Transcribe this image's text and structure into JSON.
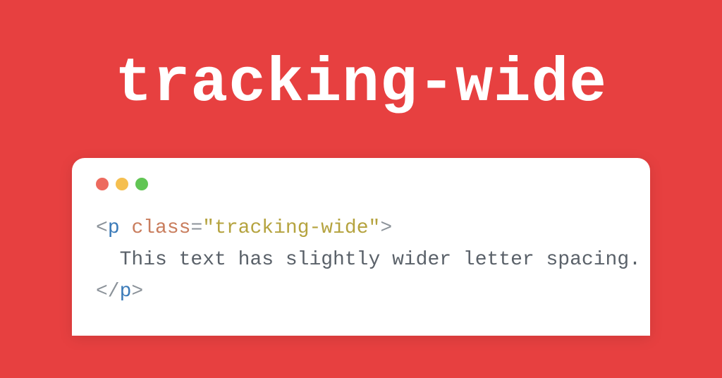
{
  "title": "tracking-wide",
  "code": {
    "tag_name": "p",
    "attr_name": "class",
    "attr_value": "\"tracking-wide\"",
    "text_content": "This text has slightly wider letter spacing.",
    "open_bracket": "<",
    "close_bracket": ">",
    "close_open_bracket": "</",
    "equals": "=",
    "space": " "
  }
}
